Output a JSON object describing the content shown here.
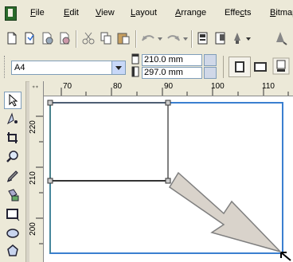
{
  "menu": {
    "items": [
      "File",
      "Edit",
      "View",
      "Layout",
      "Arrange",
      "Effects",
      "Bitmaps"
    ],
    "underline": [
      "F",
      "E",
      "V",
      "L",
      "A",
      "c",
      "B"
    ]
  },
  "propertybar": {
    "paper_size": "A4",
    "width": "210.0 mm",
    "height": "297.0 mm"
  },
  "rulers": {
    "horizontal": [
      "70",
      "80",
      "90",
      "100",
      "110"
    ],
    "vertical": [
      "220",
      "210",
      "200"
    ]
  },
  "icons": {
    "toolbar": [
      "new-icon",
      "open-icon",
      "save-icon",
      "print-icon",
      "cut-icon",
      "copy-icon",
      "paste-icon",
      "undo-icon",
      "redo-icon",
      "import-icon",
      "export-icon",
      "application-launcher-icon"
    ],
    "toolbox": [
      "pick-tool-icon",
      "shape-tool-icon",
      "crop-tool-icon",
      "zoom-tool-icon",
      "freehand-tool-icon",
      "smart-fill-icon",
      "rectangle-tool-icon",
      "ellipse-tool-icon",
      "polygon-tool-icon"
    ]
  },
  "colors": {
    "chrome": "#ece9d8",
    "page_border": "#3a7fd0",
    "arrow_fill": "#d9d3cb",
    "arrow_stroke": "#7f7f7f"
  }
}
